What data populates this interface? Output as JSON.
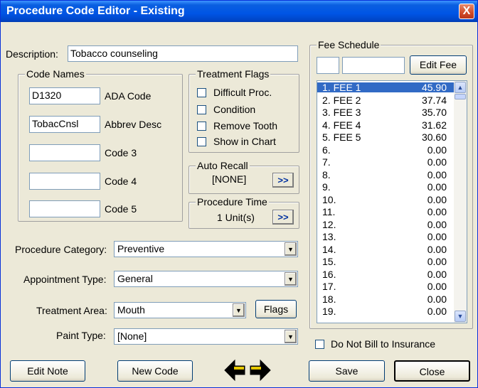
{
  "window": {
    "title": "Procedure Code Editor - Existing",
    "close_glyph": "X"
  },
  "description": {
    "label": "Description:",
    "value": "Tobacco counseling"
  },
  "code_names": {
    "title": "Code Names",
    "rows": [
      {
        "value": "D1320",
        "label": "ADA Code"
      },
      {
        "value": "TobacCnsl",
        "label": "Abbrev Desc"
      },
      {
        "value": "",
        "label": "Code 3"
      },
      {
        "value": "",
        "label": "Code 4"
      },
      {
        "value": "",
        "label": "Code 5"
      }
    ]
  },
  "treatment_flags": {
    "title": "Treatment Flags",
    "items": [
      {
        "label": "Difficult Proc.",
        "checked": false
      },
      {
        "label": "Condition",
        "checked": false
      },
      {
        "label": "Remove Tooth",
        "checked": false
      },
      {
        "label": "Show in Chart",
        "checked": false
      }
    ]
  },
  "auto_recall": {
    "title": "Auto Recall",
    "value": "[NONE]",
    "button": ">>"
  },
  "procedure_time": {
    "title": "Procedure Time",
    "value": "1  Unit(s)",
    "button": ">>"
  },
  "dropdowns": {
    "category": {
      "label": "Procedure Category:",
      "value": "Preventive"
    },
    "appointment": {
      "label": "Appointment Type:",
      "value": "General"
    },
    "treatment_area": {
      "label": "Treatment Area:",
      "value": "Mouth"
    },
    "paint": {
      "label": "Paint Type:",
      "value": "[None]"
    }
  },
  "flags_button": "Flags",
  "fee_schedule": {
    "title": "Fee Schedule",
    "edit_fee": "Edit Fee",
    "small_value": "",
    "fee_value": "",
    "rows": [
      {
        "n": "1. FEE 1",
        "v": "45.90"
      },
      {
        "n": "2. FEE 2",
        "v": "37.74"
      },
      {
        "n": "3. FEE 3",
        "v": "35.70"
      },
      {
        "n": "4. FEE 4",
        "v": "31.62"
      },
      {
        "n": "5. FEE 5",
        "v": "30.60"
      },
      {
        "n": "6.",
        "v": "0.00"
      },
      {
        "n": "7.",
        "v": "0.00"
      },
      {
        "n": "8.",
        "v": "0.00"
      },
      {
        "n": "9.",
        "v": "0.00"
      },
      {
        "n": "10.",
        "v": "0.00"
      },
      {
        "n": "11.",
        "v": "0.00"
      },
      {
        "n": "12.",
        "v": "0.00"
      },
      {
        "n": "13.",
        "v": "0.00"
      },
      {
        "n": "14.",
        "v": "0.00"
      },
      {
        "n": "15.",
        "v": "0.00"
      },
      {
        "n": "16.",
        "v": "0.00"
      },
      {
        "n": "17.",
        "v": "0.00"
      },
      {
        "n": "18.",
        "v": "0.00"
      },
      {
        "n": "19.",
        "v": "0.00"
      }
    ],
    "selected_index": 0
  },
  "do_not_bill": {
    "label": "Do Not Bill to Insurance",
    "checked": false
  },
  "buttons": {
    "edit_note": "Edit Note",
    "new_code": "New Code",
    "save": "Save",
    "close": "Close"
  },
  "icons": {
    "prev": "left-arrow-icon",
    "next": "right-arrow-icon",
    "dropdown": "chevron-down-icon"
  },
  "colors": {
    "title_bar": "#0055e5",
    "selection": "#316ac5",
    "close_button": "#d14b28",
    "dialog_bg": "#ece9d8"
  }
}
